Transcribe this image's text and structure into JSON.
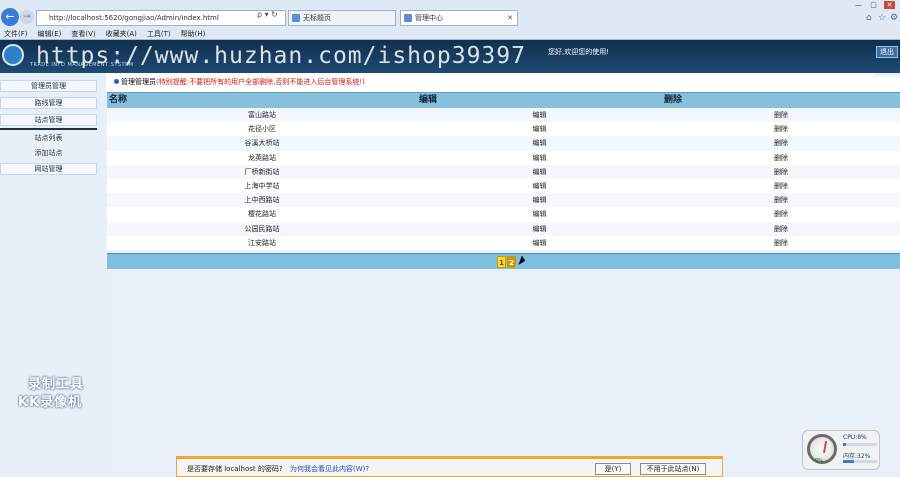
{
  "browser": {
    "address": "http://localhost:5620/gongjiao/Admin/index.html",
    "address_controls": "ρ ▾ ↻",
    "tabs": [
      {
        "label": "无标题页"
      },
      {
        "label": "管理中心"
      }
    ],
    "tab_close": "✕",
    "window_controls": [
      "—",
      "▢",
      "✕"
    ],
    "right_icons": [
      "⌂",
      "☆",
      "⚙"
    ],
    "menu": [
      "文件(F)",
      "编辑(E)",
      "查看(V)",
      "收藏夹(A)",
      "工具(T)",
      "帮助(H)"
    ]
  },
  "header": {
    "logo_sub": "TRADE INFO MANAGEMENT SYSTEM",
    "watermark": "https://www.huzhan.com/ishop39397",
    "welcome": "您好,欢迎您的使用!",
    "exit_label": "退出"
  },
  "sidebar": {
    "items": [
      {
        "label": "管理员管理"
      },
      {
        "label": "路线管理"
      },
      {
        "label": "站点管理"
      }
    ],
    "sub_items": [
      {
        "label": "站点列表"
      },
      {
        "label": "添加站点"
      }
    ],
    "items2": [
      {
        "label": "网站管理"
      }
    ],
    "recorder": [
      "录制工具",
      "KK录像机"
    ]
  },
  "main": {
    "breadcrumb": "管理管理员",
    "warning": "(特别提醒:不要把所有的用户全部删除,否则不能进入后台管理系统!)",
    "columns": [
      "名称",
      "编辑",
      "删除"
    ],
    "rows": [
      {
        "name": "富山路站",
        "edit": "编辑",
        "delete": "删除"
      },
      {
        "name": "花径小区",
        "edit": "编辑",
        "delete": "删除"
      },
      {
        "name": "谷溪大桥站",
        "edit": "编辑",
        "delete": "删除"
      },
      {
        "name": "龙英路站",
        "edit": "编辑",
        "delete": "删除"
      },
      {
        "name": "厂桥新街站",
        "edit": "编辑",
        "delete": "删除"
      },
      {
        "name": "上海中学站",
        "edit": "编辑",
        "delete": "删除"
      },
      {
        "name": "上中西路站",
        "edit": "编辑",
        "delete": "删除"
      },
      {
        "name": "樱花路站",
        "edit": "编辑",
        "delete": "删除"
      },
      {
        "name": "公园民路站",
        "edit": "编辑",
        "delete": "删除"
      },
      {
        "name": "江安路站",
        "edit": "编辑",
        "delete": "删除"
      }
    ],
    "pages": [
      "1",
      "2"
    ],
    "current_page": "2"
  },
  "notification": {
    "text": "是否要存储 localhost 的密码?",
    "link": "为何我会看见此内容(W)?",
    "yes_label": "是(Y)",
    "never_label": "不用于此站点(N)"
  },
  "perf": {
    "gauge_value": "0%",
    "cpu_label": "CPU:8%",
    "mem_label": "内存:32%",
    "cpu_pct": 8,
    "mem_pct": 32
  }
}
